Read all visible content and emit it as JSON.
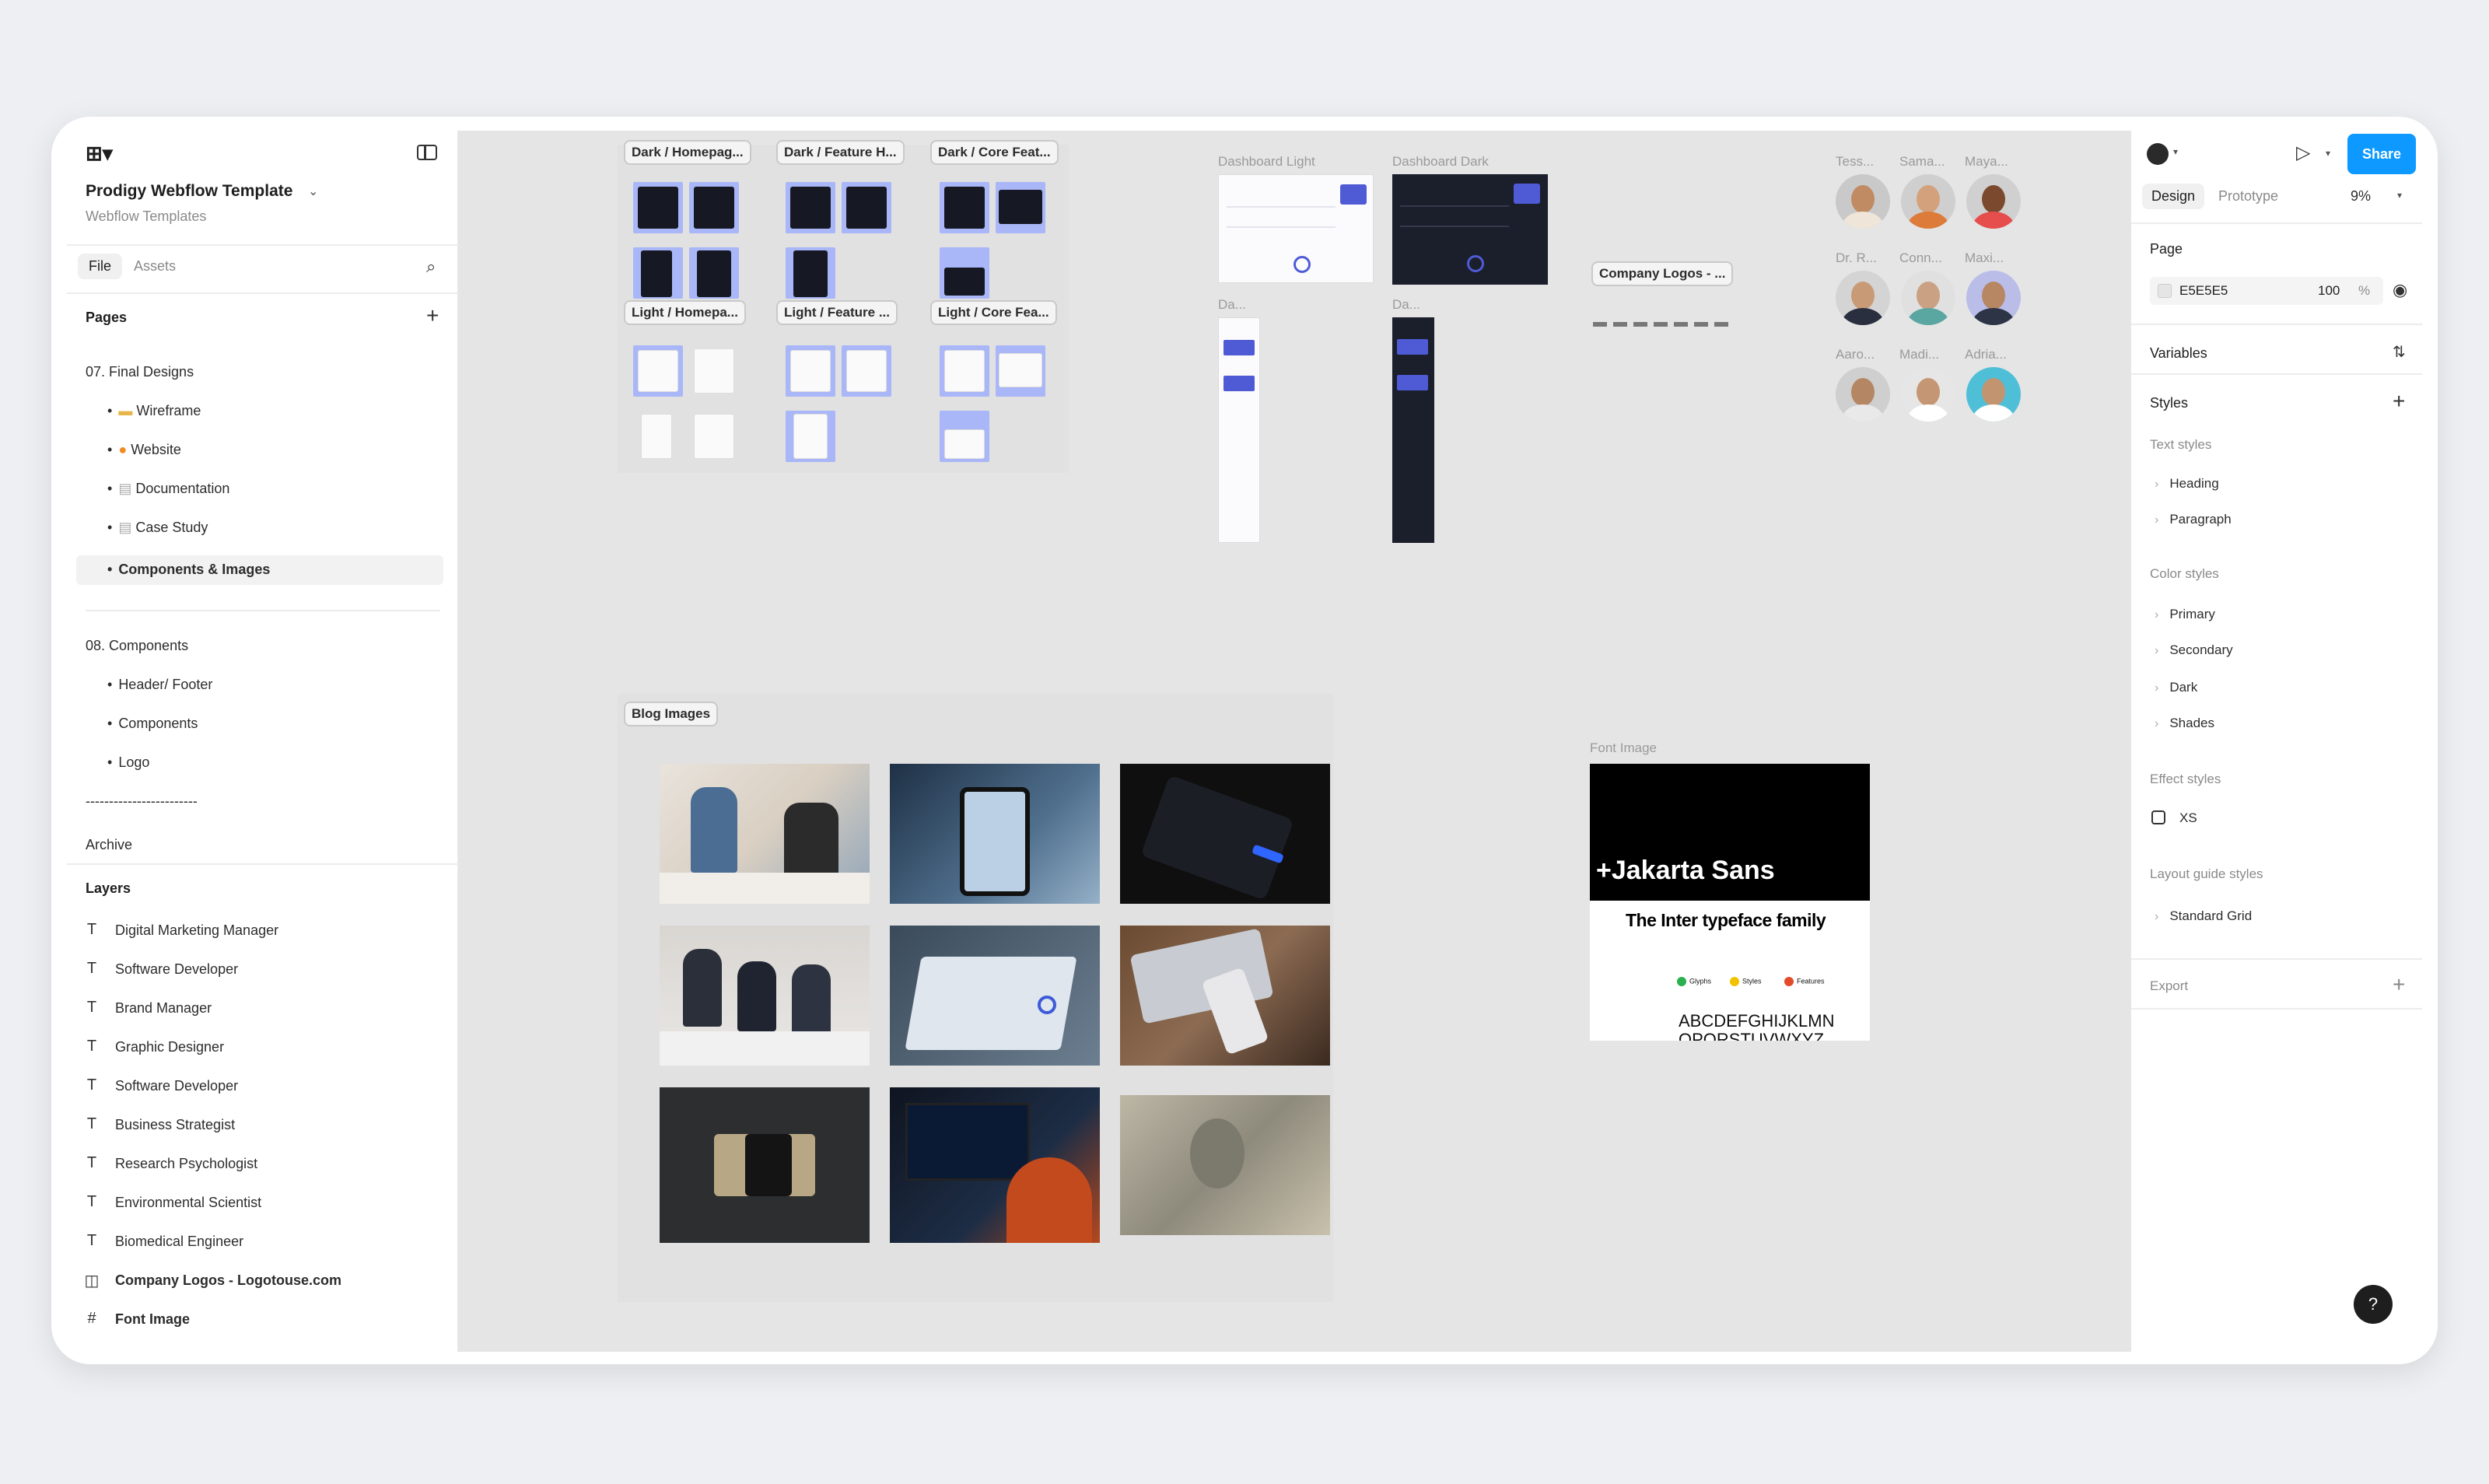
{
  "app": {
    "file_title": "Prodigy Webflow Template",
    "team": "Webflow Templates"
  },
  "left": {
    "tabs": [
      "File",
      "Assets"
    ],
    "pages_label": "Pages",
    "pages": [
      {
        "label": "07. Final Designs"
      },
      {
        "label": "Wireframe",
        "icon": "folder-icon"
      },
      {
        "label": "Website",
        "icon": "fire-icon"
      },
      {
        "label": "Documentation",
        "icon": "document-icon"
      },
      {
        "label": "Case Study",
        "icon": "document-icon"
      },
      {
        "label": "Components & Images"
      },
      {
        "label": "08. Components"
      },
      {
        "label": "Header/ Footer"
      },
      {
        "label": "Components"
      },
      {
        "label": "Logo"
      },
      {
        "label": "------------------------"
      },
      {
        "label": "Archive"
      }
    ],
    "layers_label": "Layers",
    "layers": [
      {
        "label": "Digital Marketing Manager",
        "icon": "text-icon"
      },
      {
        "label": "Software Developer",
        "icon": "text-icon"
      },
      {
        "label": "Brand Manager",
        "icon": "text-icon"
      },
      {
        "label": "Graphic Designer",
        "icon": "text-icon"
      },
      {
        "label": "Software Developer",
        "icon": "text-icon"
      },
      {
        "label": "Business Strategist",
        "icon": "text-icon"
      },
      {
        "label": "Research Psychologist",
        "icon": "text-icon"
      },
      {
        "label": "Environmental Scientist",
        "icon": "text-icon"
      },
      {
        "label": "Biomedical Engineer",
        "icon": "text-icon"
      },
      {
        "label": "Company Logos - Logotouse.com",
        "icon": "component-icon"
      },
      {
        "label": "Font Image",
        "icon": "frame-icon"
      }
    ]
  },
  "canvas": {
    "frame_labels": [
      "Dark / Homepag...",
      "Dark / Feature H...",
      "Dark / Core Feat...",
      "Light / Homepa...",
      "Light / Feature ...",
      "Light / Core Fea...",
      "Company Logos - ...",
      "Blog Images"
    ],
    "plain_labels": [
      "Dashboard Light",
      "Dashboard Dark",
      "Da...",
      "Da...",
      "Font Image"
    ],
    "people_names": [
      "Tess...",
      "Sama...",
      "Maya...",
      "Dr. R...",
      "Conn...",
      "Maxi...",
      "Aaro...",
      "Madi...",
      "Adria..."
    ],
    "font_card": {
      "headline": "+Jakarta Sans",
      "subhead": "The Inter typeface family",
      "chips": [
        "Glyphs",
        "Styles",
        "Features"
      ],
      "alphabet": "ABCDEFGHIJKLMN",
      "alphabet2": "OPQRSTUVWXYZ"
    }
  },
  "toolbar": {
    "tools": [
      {
        "name": "move-tool",
        "icon": "cursor-icon"
      },
      {
        "name": "frame-tool",
        "icon": "frame-icon"
      },
      {
        "name": "shape-tool",
        "icon": "rectangle-icon"
      },
      {
        "name": "pen-tool",
        "icon": "pen-icon"
      },
      {
        "name": "text-tool",
        "icon": "text-icon"
      },
      {
        "name": "comment-tool",
        "icon": "comment-icon"
      },
      {
        "name": "actions-tool",
        "icon": "actions-icon"
      },
      {
        "name": "draw-mode",
        "icon": "draw-icon"
      },
      {
        "name": "design-mode",
        "icon": "design-icon"
      },
      {
        "name": "dev-mode",
        "icon": "code-icon"
      }
    ]
  },
  "right": {
    "share_label": "Share",
    "tabs": [
      "Design",
      "Prototype"
    ],
    "zoom": "9%",
    "page_label": "Page",
    "bg_hex": "E5E5E5",
    "bg_opacity": "100",
    "bg_opacity_unit": "%",
    "variables_label": "Variables",
    "styles_label": "Styles",
    "text_styles_label": "Text styles",
    "text_styles": [
      "Heading",
      "Paragraph"
    ],
    "color_styles_label": "Color styles",
    "color_styles": [
      "Primary",
      "Secondary",
      "Dark",
      "Shades"
    ],
    "effect_styles_label": "Effect styles",
    "effect_styles": [
      "XS"
    ],
    "layout_styles_label": "Layout guide styles",
    "layout_styles": [
      "Standard Grid"
    ],
    "export_label": "Export",
    "help": "?"
  },
  "colors": {
    "accent": "#0d99ff",
    "canvas_bg": "#e5e5e5",
    "dashboard_accent": "#4f5bd5"
  }
}
